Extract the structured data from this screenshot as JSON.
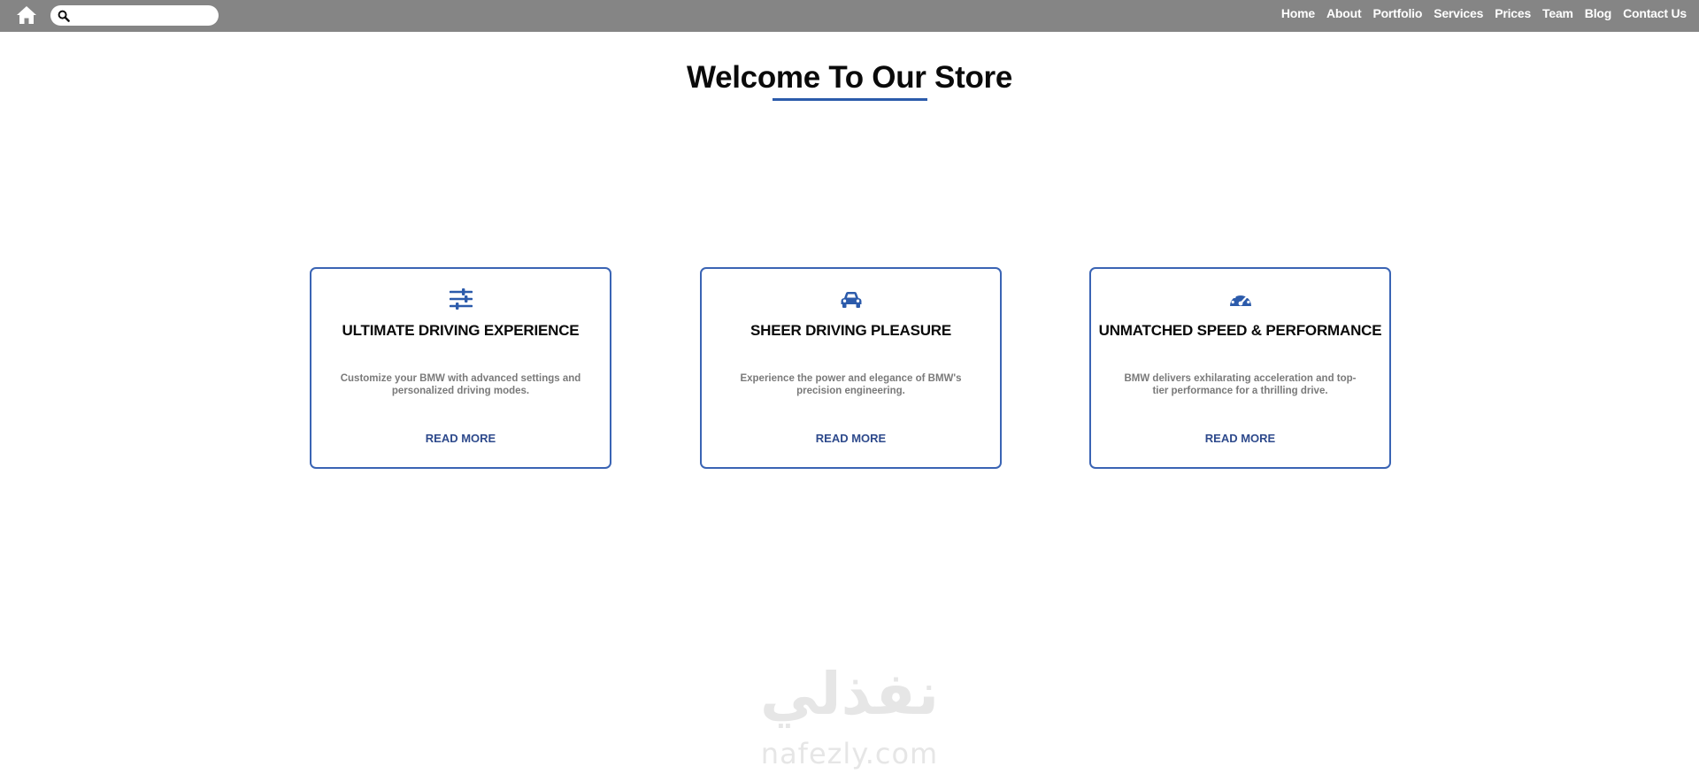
{
  "header": {
    "home_icon": "home-icon",
    "search": {
      "icon": "search-icon",
      "value": "",
      "placeholder": ""
    },
    "nav": [
      "Home",
      "About",
      "Portfolio",
      "Services",
      "Prices",
      "Team",
      "Blog",
      "Contact Us"
    ]
  },
  "main": {
    "title": "Welcome To Our Store",
    "accent_color": "#2c5bab",
    "cards": [
      {
        "icon": "sliders-icon",
        "title": "ULTIMATE DRIVING EXPERIENCE",
        "text": "Customize your BMW with advanced settings and personalized driving modes.",
        "link": "READ MORE"
      },
      {
        "icon": "car-icon",
        "title": "SHEER DRIVING PLEASURE",
        "text": "Experience the power and elegance of BMW's precision engineering.",
        "link": "READ MORE"
      },
      {
        "icon": "speedometer-icon",
        "title": "UNMATCHED SPEED & PERFORMANCE",
        "text": "BMW delivers exhilarating acceleration and top-tier performance for a thrilling drive.",
        "link": "READ MORE"
      }
    ]
  },
  "watermark": {
    "arabic": "نفذلي",
    "latin": "nafezly.com"
  }
}
